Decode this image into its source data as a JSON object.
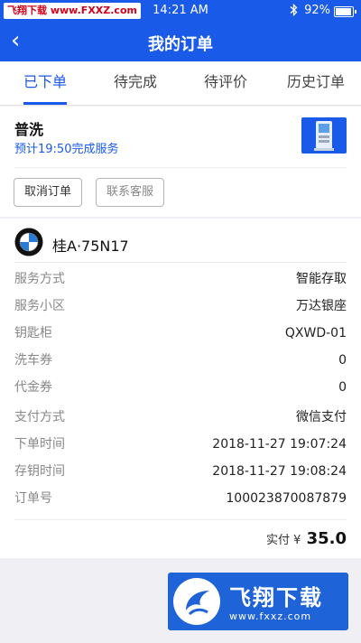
{
  "status_bar": {
    "watermark_prefix": "飞翔下载",
    "watermark_url": "www.FXXZ.com",
    "time": "14:21 AM",
    "bluetooth_icon": "bluetooth-icon",
    "battery_percent": "92%",
    "battery_level": 0.92
  },
  "nav": {
    "back_icon": "‹",
    "title": "我的订单"
  },
  "tabs": [
    {
      "label": "已下单",
      "active": true
    },
    {
      "label": "待完成",
      "active": false
    },
    {
      "label": "待评价",
      "active": false
    },
    {
      "label": "历史订单",
      "active": false
    }
  ],
  "order": {
    "service_name": "普洗",
    "eta": "预计19:50完成服务",
    "kiosk_icon": "kiosk-icon",
    "cancel_label": "取消订单",
    "contact_label": "联系客服"
  },
  "car": {
    "brand_icon": "bmw-logo",
    "plate": "桂A·75N17"
  },
  "details": [
    {
      "label": "服务方式",
      "value": "智能存取"
    },
    {
      "label": "服务小区",
      "value": "万达银座"
    },
    {
      "label": "钥匙柜",
      "value": "QXWD-01"
    },
    {
      "label": "洗车券",
      "value": "0"
    },
    {
      "label": "代金券",
      "value": "0"
    },
    {
      "label": "支付方式",
      "value": "微信支付"
    },
    {
      "label": "下单时间",
      "value": "2018-11-27  19:07:24"
    },
    {
      "label": "存钥时间",
      "value": "2018-11-27  19:08:24"
    },
    {
      "label": "订单号",
      "value": "100023870087879"
    }
  ],
  "total": {
    "label": "实付",
    "currency": "¥",
    "amount": "35.0"
  },
  "watermark": {
    "brand": "飞翔下载",
    "site": "www.fxxz.com"
  },
  "colors": {
    "accent": "#1a5ae8",
    "background": "#efeff4"
  }
}
